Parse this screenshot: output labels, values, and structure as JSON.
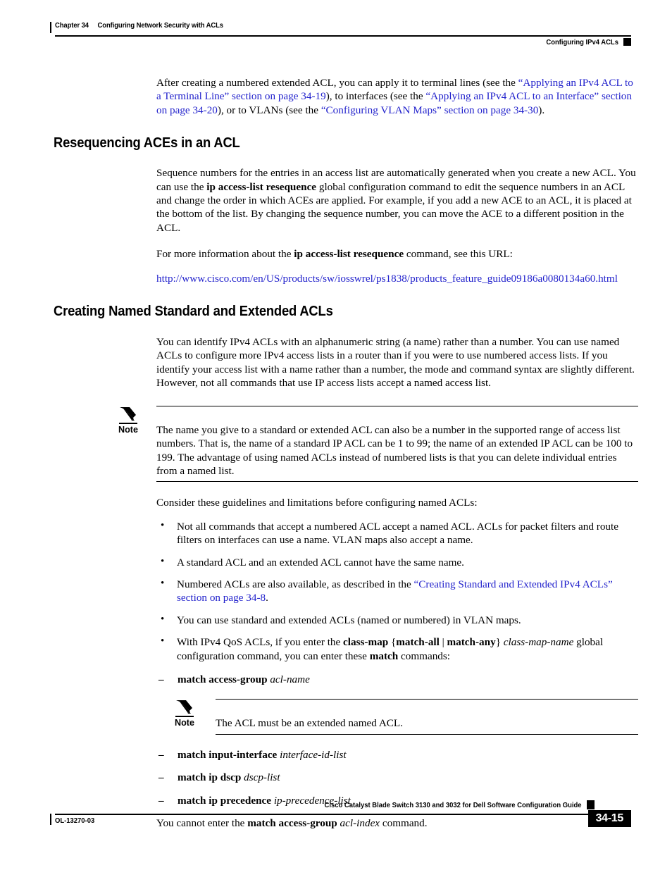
{
  "header": {
    "chapter": "Chapter 34",
    "chapter_title": "Configuring Network Security with ACLs",
    "section_title": "Configuring IPv4 ACLs"
  },
  "footer": {
    "doc_number": "OL-13270-03",
    "guide_title": "Cisco Catalyst Blade Switch 3130 and 3032 for Dell Software Configuration Guide",
    "page_number": "34-15"
  },
  "colors": {
    "link": "#2222cc",
    "text": "#000000",
    "page_background": "#ffffff"
  },
  "intro_paragraph": {
    "t1": "After creating a numbered extended ACL, you can apply it to terminal lines (see the ",
    "link1": "“Applying an IPv4 ACL to a Terminal Line” section on page 34-19",
    "t2": "), to interfaces (see the ",
    "link2": "“Applying an IPv4 ACL to an Interface” section on page 34-20",
    "t3": "), or to VLANs (see the ",
    "link3": "“Configuring VLAN Maps” section on page 34-30",
    "t4": ")."
  },
  "section_resequencing": {
    "heading": "Resequencing ACEs in an ACL",
    "para1": {
      "t1": "Sequence numbers for the entries in an access list are automatically generated when you create a new ACL. You can use the ",
      "cmd1": "ip access-list resequence",
      "t2": " global configuration command to edit the sequence numbers in an ACL and change the order in which ACEs are applied. For example, if you add a new ACE to an ACL, it is placed at the bottom of the list. By changing the sequence number, you can move the ACE to a different position in the ACL."
    },
    "para2": {
      "t1": "For more information about the ",
      "cmd1": "ip access-list resequence",
      "t2": " command, see this URL:"
    },
    "url": "http://www.cisco.com/en/US/products/sw/iosswrel/ps1838/products_feature_guide09186a0080134a60.html"
  },
  "section_named_acls": {
    "heading": "Creating Named Standard and Extended ACLs",
    "para1": "You can identify IPv4 ACLs with an alphanumeric string (a name) rather than a number. You can use named ACLs to configure more IPv4 access lists in a router than if you were to use numbered access lists. If you identify your access list with a name rather than a number, the mode and command syntax are slightly different. However, not all commands that use IP access lists accept a named access list.",
    "note1": {
      "label": "Note",
      "text": "The name you give to a standard or extended ACL can also be a number in the supported range of access list numbers. That is, the name of a standard IP ACL can be 1 to 99; the name of an extended IP ACL can be 100 to 199. The advantage of using named ACLs instead of numbered lists is that you can delete individual entries from a named list."
    },
    "guidelines_intro": "Consider these guidelines and limitations before configuring named ACLs:",
    "bullet_marker": "•",
    "dash_marker": "–",
    "bullets": [
      {
        "id": "bullet-1",
        "text": "Not all commands that accept a numbered ACL accept a named ACL. ACLs for packet filters and route filters on interfaces can use a name. VLAN maps also accept a name."
      },
      {
        "id": "bullet-2",
        "text": "A standard ACL and an extended ACL cannot have the same name."
      },
      {
        "id": "bullet-3",
        "t1": "Numbered ACLs are also available, as described in the ",
        "link1": "“Creating Standard and Extended IPv4 ACLs” section on page 34-8",
        "t2": "."
      },
      {
        "id": "bullet-4",
        "text": "You can use standard and extended ACLs (named or numbered) in VLAN maps."
      },
      {
        "id": "bullet-5",
        "t1": "With IPv4 QoS ACLs, if you enter the ",
        "cmd1": "class-map",
        "t2": " {",
        "cmd2": "match-all",
        "t3": " | ",
        "cmd3": "match-any",
        "t4": "} ",
        "var1": "class-map-name",
        "t5": " global configuration command, you can enter these ",
        "cmd4": "match",
        "t6": " commands:"
      }
    ],
    "match_commands_1": [
      {
        "cmd": "match access-group",
        "var": "acl-name"
      }
    ],
    "note2": {
      "label": "Note",
      "text": "The ACL must be an extended named ACL."
    },
    "match_commands_2": [
      {
        "cmd": "match input-interface",
        "var": "interface-id-list"
      },
      {
        "cmd": "match ip dscp",
        "var": "dscp-list"
      },
      {
        "cmd": "match ip precedence",
        "var": "ip-precedence-list"
      }
    ],
    "closing": {
      "t1": "You cannot enter the ",
      "cmd1": "match access-group",
      "t2": " ",
      "var1": "acl-index",
      "t3": " command."
    }
  },
  "icons": {
    "note_pencil": "pencil-icon"
  }
}
